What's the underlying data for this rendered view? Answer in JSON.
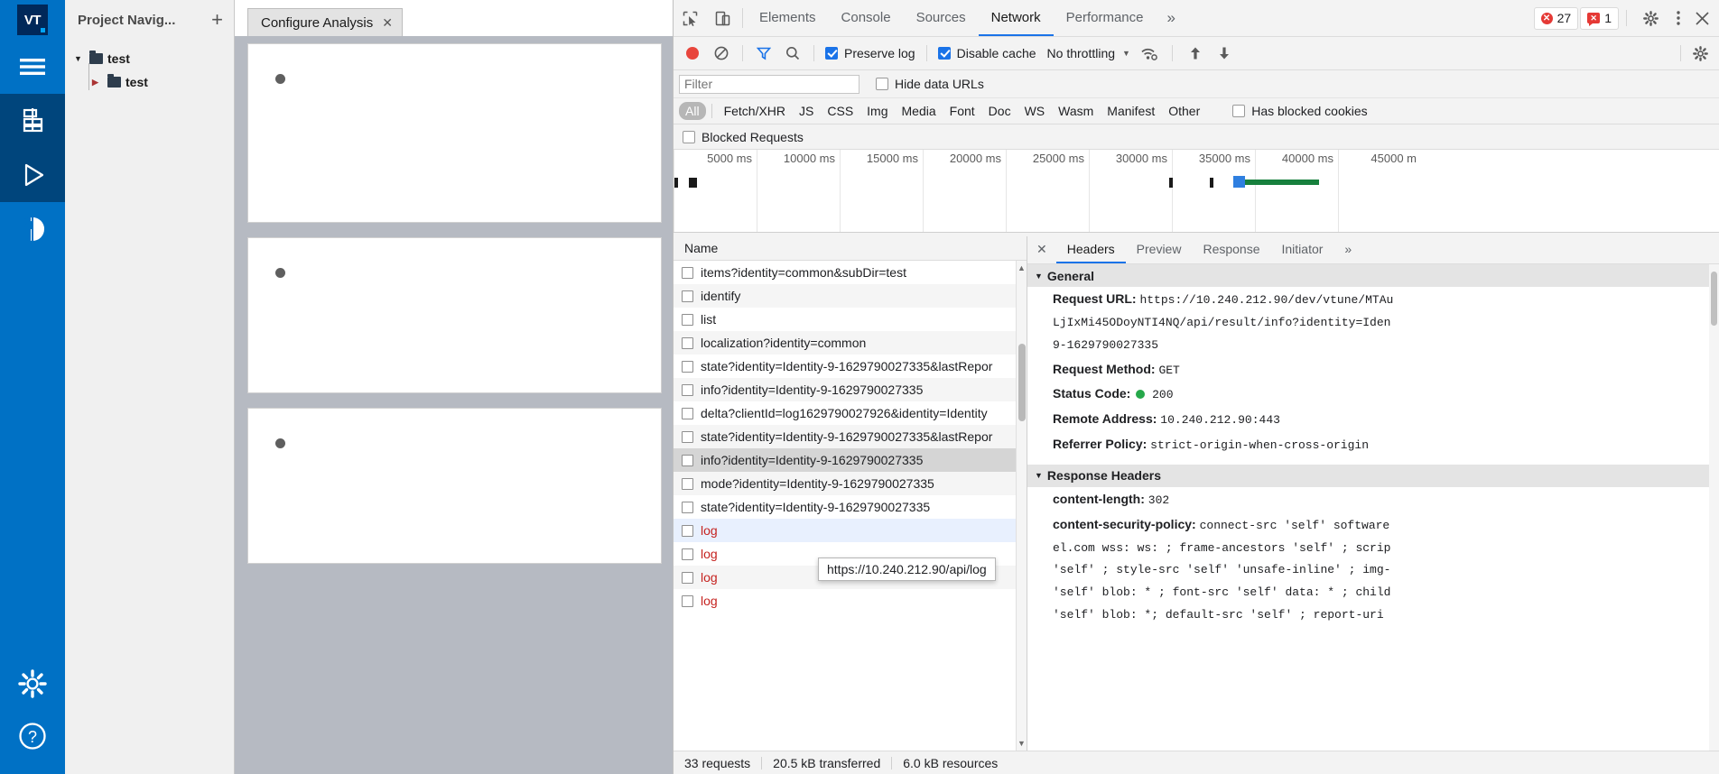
{
  "rail": {
    "logo_text": "VT",
    "items": [
      {
        "name": "menu-icon",
        "label": "Menu"
      },
      {
        "name": "project-icon",
        "label": "Project"
      },
      {
        "name": "run-icon",
        "label": "Run Analysis"
      },
      {
        "name": "compare-icon",
        "label": "Compare"
      }
    ],
    "bottom_items": [
      {
        "name": "settings-icon",
        "label": "Settings"
      },
      {
        "name": "help-icon",
        "label": "Help"
      }
    ]
  },
  "navigator": {
    "title": "Project Navig...",
    "add_label": "+",
    "tree": [
      {
        "label": "test",
        "expanded": true,
        "caret": "▼"
      },
      {
        "label": "test",
        "expanded": false,
        "caret": "▶"
      }
    ]
  },
  "editor": {
    "tab_label": "Configure Analysis",
    "tab_close": "✕",
    "cards": [
      {
        "id": "card-1"
      },
      {
        "id": "card-2"
      },
      {
        "id": "card-3"
      }
    ]
  },
  "devtools": {
    "tabs": [
      {
        "label": "Elements",
        "active": false
      },
      {
        "label": "Console",
        "active": false
      },
      {
        "label": "Sources",
        "active": false
      },
      {
        "label": "Network",
        "active": true
      },
      {
        "label": "Performance",
        "active": false
      }
    ],
    "more_tabs": "»",
    "error_count": "27",
    "warning_count": "1",
    "controls": {
      "preserve_log": {
        "label": "Preserve log",
        "checked": true
      },
      "disable_cache": {
        "label": "Disable cache",
        "checked": true
      },
      "throttling": "No throttling",
      "throttle_caret": "▼"
    },
    "filter": {
      "placeholder": "Filter",
      "value": "",
      "hide_data_urls": {
        "label": "Hide data URLs",
        "checked": false
      },
      "has_blocked_cookies": {
        "label": "Has blocked cookies",
        "checked": false
      },
      "blocked_requests": {
        "label": "Blocked Requests",
        "checked": false
      }
    },
    "types": [
      "All",
      "Fetch/XHR",
      "JS",
      "CSS",
      "Img",
      "Media",
      "Font",
      "Doc",
      "WS",
      "Wasm",
      "Manifest",
      "Other"
    ],
    "active_type": "All",
    "overview": {
      "ticks": [
        "5000 ms",
        "10000 ms",
        "15000 ms",
        "20000 ms",
        "25000 ms",
        "30000 ms",
        "35000 ms",
        "40000 ms",
        "45000 m"
      ],
      "colors": {
        "green": "#17803d",
        "blue": "#2f7fe0",
        "dark": "#1a1a1a"
      }
    },
    "requests": {
      "column_header": "Name",
      "rows": [
        {
          "name": "items?identity=common&subDir=test",
          "state": "normal"
        },
        {
          "name": "identify",
          "state": "alt"
        },
        {
          "name": "list",
          "state": "normal"
        },
        {
          "name": "localization?identity=common",
          "state": "alt"
        },
        {
          "name": "state?identity=Identity-9-1629790027335&lastRepor",
          "state": "normal"
        },
        {
          "name": "info?identity=Identity-9-1629790027335",
          "state": "alt"
        },
        {
          "name": "delta?clientId=log1629790027926&identity=Identity",
          "state": "normal"
        },
        {
          "name": "state?identity=Identity-9-1629790027335&lastRepor",
          "state": "alt"
        },
        {
          "name": "info?identity=Identity-9-1629790027335",
          "state": "selected"
        },
        {
          "name": "mode?identity=Identity-9-1629790027335",
          "state": "alt"
        },
        {
          "name": "state?identity=Identity-9-1629790027335",
          "state": "normal"
        },
        {
          "name": "log",
          "state": "hl-red"
        },
        {
          "name": "log",
          "state": "red"
        },
        {
          "name": "log",
          "state": "red-alt"
        },
        {
          "name": "log",
          "state": "red"
        }
      ]
    },
    "detail": {
      "close_label": "✕",
      "tabs": [
        {
          "label": "Headers",
          "active": true
        },
        {
          "label": "Preview",
          "active": false
        },
        {
          "label": "Response",
          "active": false
        },
        {
          "label": "Initiator",
          "active": false
        }
      ],
      "more": "»",
      "general": {
        "section_label": "General",
        "caret": "▼",
        "request_url_label": "Request URL:",
        "request_url_lines": [
          "https://10.240.212.90/dev/vtune/MTAu",
          "LjIxMi45ODoyNTI4NQ/api/result/info?identity=Iden",
          "9-1629790027335"
        ],
        "request_method_label": "Request Method:",
        "request_method": "GET",
        "status_code_label": "Status Code:",
        "status_code": "200",
        "remote_address_label": "Remote Address:",
        "remote_address": "10.240.212.90:443",
        "referrer_policy_label": "Referrer Policy:",
        "referrer_policy": "strict-origin-when-cross-origin"
      },
      "response_headers": {
        "section_label": "Response Headers",
        "caret": "▼",
        "items": [
          {
            "key": "content-length:",
            "value": "302"
          },
          {
            "key": "content-security-policy:",
            "value": "connect-src 'self' software"
          }
        ],
        "wrapped_lines": [
          "el.com wss: ws: ; frame-ancestors 'self' ; scrip",
          "'self' ; style-src 'self' 'unsafe-inline' ; img-",
          "'self' blob: * ; font-src 'self' data: * ; child",
          "'self' blob: *; default-src 'self' ; report-uri"
        ]
      }
    },
    "status_bar": {
      "requests": "33 requests",
      "transferred": "20.5 kB transferred",
      "resources": "6.0 kB resources"
    },
    "tooltip": "https://10.240.212.90/api/log"
  }
}
